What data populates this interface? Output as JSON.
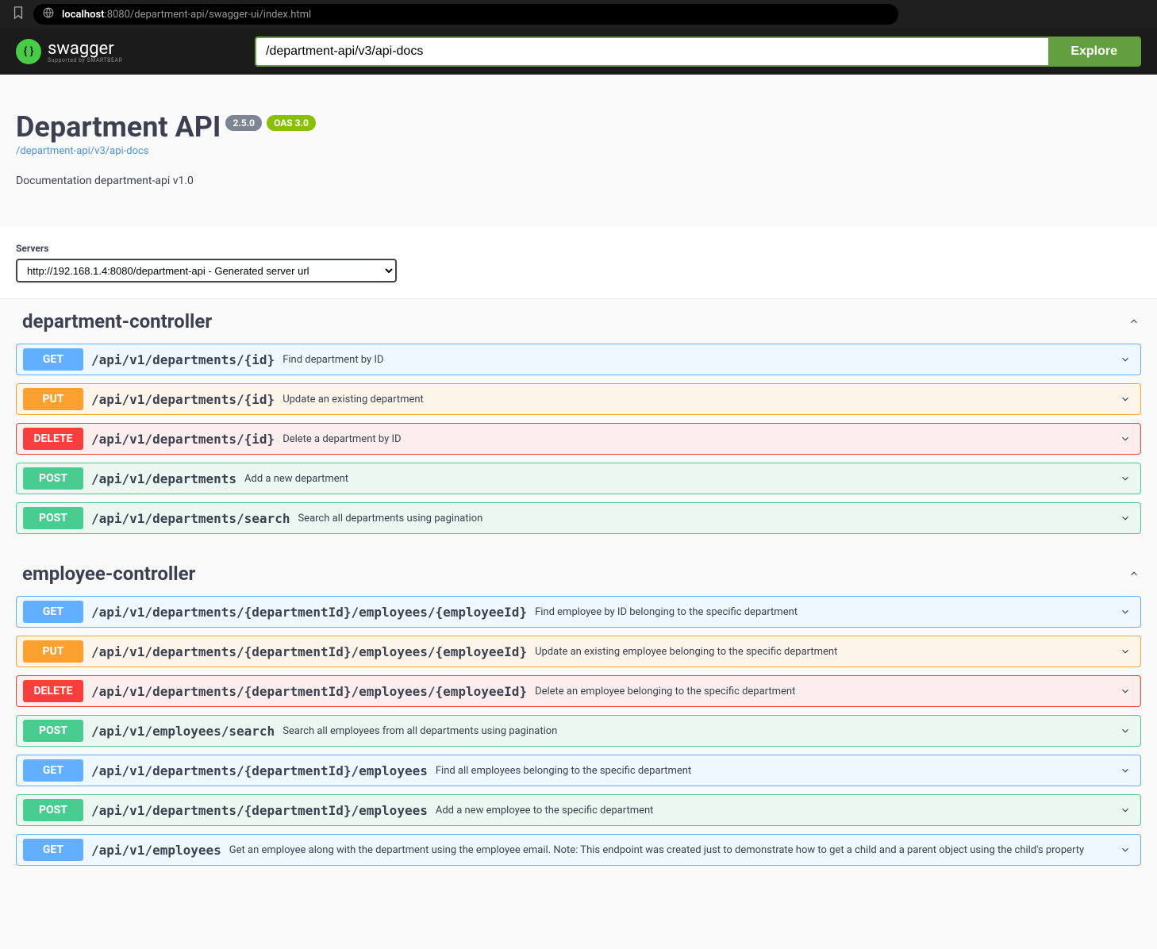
{
  "browser": {
    "url_host": "localhost",
    "url_rest": ":8080/department-api/swagger-ui/index.html"
  },
  "topbar": {
    "logo_name": "swagger",
    "logo_sub": "Supported by SMARTBEAR",
    "explore_input": "/department-api/v3/api-docs",
    "explore_btn": "Explore"
  },
  "header": {
    "title": "Department API",
    "version": "2.5.0",
    "oas": "OAS 3.0",
    "docs_link": "/department-api/v3/api-docs",
    "description": "Documentation department-api v1.0"
  },
  "servers": {
    "label": "Servers",
    "selected": "http://192.168.1.4:8080/department-api - Generated server url"
  },
  "tags": [
    {
      "name": "department-controller",
      "ops": [
        {
          "method": "GET",
          "cls": "op-get",
          "path": "/api/v1/departments/{id}",
          "summary": "Find department by ID"
        },
        {
          "method": "PUT",
          "cls": "op-put",
          "path": "/api/v1/departments/{id}",
          "summary": "Update an existing department"
        },
        {
          "method": "DELETE",
          "cls": "op-delete",
          "path": "/api/v1/departments/{id}",
          "summary": "Delete a department by ID"
        },
        {
          "method": "POST",
          "cls": "op-post",
          "path": "/api/v1/departments",
          "summary": "Add a new department"
        },
        {
          "method": "POST",
          "cls": "op-post",
          "path": "/api/v1/departments/search",
          "summary": "Search all departments using pagination"
        }
      ]
    },
    {
      "name": "employee-controller",
      "ops": [
        {
          "method": "GET",
          "cls": "op-get",
          "path": "/api/v1/departments/{departmentId}/employees/{employeeId}",
          "summary": "Find employee by ID belonging to the specific department"
        },
        {
          "method": "PUT",
          "cls": "op-put",
          "path": "/api/v1/departments/{departmentId}/employees/{employeeId}",
          "summary": "Update an existing employee belonging to the specific department"
        },
        {
          "method": "DELETE",
          "cls": "op-delete",
          "path": "/api/v1/departments/{departmentId}/employees/{employeeId}",
          "summary": "Delete an employee belonging to the specific department"
        },
        {
          "method": "POST",
          "cls": "op-post",
          "path": "/api/v1/employees/search",
          "summary": "Search all employees from all departments using pagination"
        },
        {
          "method": "GET",
          "cls": "op-get",
          "path": "/api/v1/departments/{departmentId}/employees",
          "summary": "Find all employees belonging to the specific department"
        },
        {
          "method": "POST",
          "cls": "op-post",
          "path": "/api/v1/departments/{departmentId}/employees",
          "summary": "Add a new employee to the specific department"
        },
        {
          "method": "GET",
          "cls": "op-get",
          "path": "/api/v1/employees",
          "summary": "Get an employee along with the department using the employee email. Note: This endpoint was created just to demonstrate how to get a child and a parent object using the child's property"
        }
      ]
    }
  ]
}
